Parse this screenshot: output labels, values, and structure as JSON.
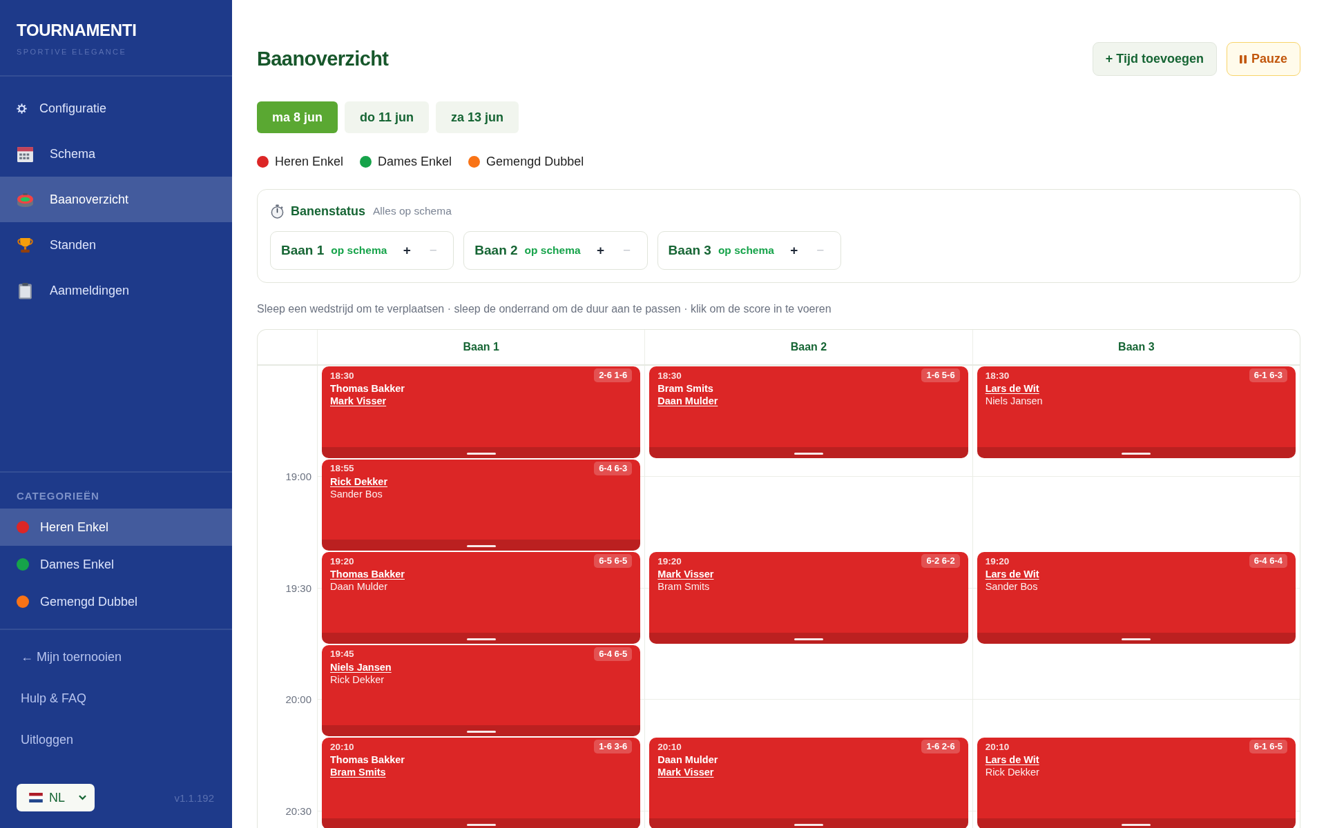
{
  "sidebar": {
    "logo": {
      "title": "TOURNAMENTI",
      "subtitle": "SPORTIVE ELEGANCE"
    },
    "nav_items": [
      {
        "label": "Configuratie",
        "selected": false
      },
      {
        "label": "Schema",
        "selected": false
      },
      {
        "label": "Baanoverzicht",
        "selected": true
      },
      {
        "label": "Standen",
        "selected": false
      },
      {
        "label": "Aanmeldingen",
        "selected": false
      }
    ],
    "categories": {
      "heading": "CATEGORIEËN",
      "items": [
        {
          "label": "Heren Enkel",
          "color": "#dc2626",
          "selected": true
        },
        {
          "label": "Dames Enkel",
          "color": "#16a34a",
          "selected": false
        },
        {
          "label": "Gemengd Dubbel",
          "color": "#f97316",
          "selected": false
        }
      ]
    },
    "links": [
      "← Mijn toernooien",
      "Hulp & FAQ",
      "Uitloggen"
    ],
    "language_select": {
      "value": "NL"
    },
    "version": "v1.1.192"
  },
  "header": {
    "title": "Baanoverzicht",
    "buttons": [
      {
        "label": "+ Tijd toevoegen",
        "kind": "add"
      },
      {
        "label": "Pauze",
        "kind": "pause"
      }
    ]
  },
  "date_tabs": [
    {
      "label": "ma 8 jun",
      "selected": true
    },
    {
      "label": "do 11 jun",
      "selected": false
    },
    {
      "label": "za 13 jun",
      "selected": false
    }
  ],
  "legend": [
    {
      "label": "Heren Enkel",
      "color": "#dc2626"
    },
    {
      "label": "Dames Enkel",
      "color": "#16a34a"
    },
    {
      "label": "Gemengd Dubbel",
      "color": "#f97316"
    }
  ],
  "court_status": {
    "title": "Banenstatus",
    "summary": "Alles op schema",
    "courts": [
      {
        "name": "Baan 1",
        "status": "op schema",
        "increase": {
          "label": "+",
          "disabled": false
        },
        "decrease": {
          "label": "−",
          "disabled": true
        }
      },
      {
        "name": "Baan 2",
        "status": "op schema",
        "increase": {
          "label": "+",
          "disabled": false
        },
        "decrease": {
          "label": "−",
          "disabled": true
        }
      },
      {
        "name": "Baan 3",
        "status": "op schema",
        "increase": {
          "label": "+",
          "disabled": false
        },
        "decrease": {
          "label": "−",
          "disabled": true
        }
      }
    ]
  },
  "hint": "Sleep een wedstrijd om te verplaatsen · sleep de onderrand om de duur aan te passen · klik om de score in te voeren",
  "schedule": {
    "time_labels": [
      "19:00",
      "19:30",
      "20:00",
      "20:30"
    ],
    "courts": [
      {
        "name": "Baan 1",
        "matches": [
          {
            "time": "18:30",
            "score": "2-6 1-6",
            "color": "#dc2626",
            "players": [
              {
                "name": "Thomas Bakker",
                "winner": false
              },
              {
                "name": "Mark Visser",
                "winner": true
              }
            ]
          },
          {
            "time": "18:55",
            "score": "6-4 6-3",
            "color": "#dc2626",
            "players": [
              {
                "name": "Rick Dekker",
                "winner": true
              },
              {
                "name": "Sander Bos",
                "winner": false
              }
            ]
          },
          {
            "time": "19:20",
            "score": "6-5 6-5",
            "color": "#dc2626",
            "players": [
              {
                "name": "Thomas Bakker",
                "winner": true
              },
              {
                "name": "Daan Mulder",
                "winner": false
              }
            ]
          },
          {
            "time": "19:45",
            "score": "6-4 6-5",
            "color": "#dc2626",
            "players": [
              {
                "name": "Niels Jansen",
                "winner": true
              },
              {
                "name": "Rick Dekker",
                "winner": false
              }
            ]
          },
          {
            "time": "20:10",
            "score": "1-6 3-6",
            "color": "#dc2626",
            "players": [
              {
                "name": "Thomas Bakker",
                "winner": false
              },
              {
                "name": "Bram Smits",
                "winner": true
              }
            ]
          }
        ]
      },
      {
        "name": "Baan 2",
        "matches": [
          {
            "time": "18:30",
            "score": "1-6 5-6",
            "color": "#dc2626",
            "players": [
              {
                "name": "Bram Smits",
                "winner": false
              },
              {
                "name": "Daan Mulder",
                "winner": true
              }
            ]
          },
          {
            "time": "19:20",
            "score": "6-2 6-2",
            "color": "#dc2626",
            "players": [
              {
                "name": "Mark Visser",
                "winner": true
              },
              {
                "name": "Bram Smits",
                "winner": false
              }
            ]
          },
          {
            "time": "20:10",
            "score": "1-6 2-6",
            "color": "#dc2626",
            "players": [
              {
                "name": "Daan Mulder",
                "winner": false
              },
              {
                "name": "Mark Visser",
                "winner": true
              }
            ]
          }
        ]
      },
      {
        "name": "Baan 3",
        "matches": [
          {
            "time": "18:30",
            "score": "6-1 6-3",
            "color": "#dc2626",
            "players": [
              {
                "name": "Lars de Wit",
                "winner": true
              },
              {
                "name": "Niels Jansen",
                "winner": false
              }
            ]
          },
          {
            "time": "19:20",
            "score": "6-4 6-4",
            "color": "#dc2626",
            "players": [
              {
                "name": "Lars de Wit",
                "winner": true
              },
              {
                "name": "Sander Bos",
                "winner": false
              }
            ]
          },
          {
            "time": "20:10",
            "score": "6-1 6-5",
            "color": "#dc2626",
            "players": [
              {
                "name": "Lars de Wit",
                "winner": true
              },
              {
                "name": "Rick Dekker",
                "winner": false
              }
            ]
          }
        ]
      }
    ]
  }
}
